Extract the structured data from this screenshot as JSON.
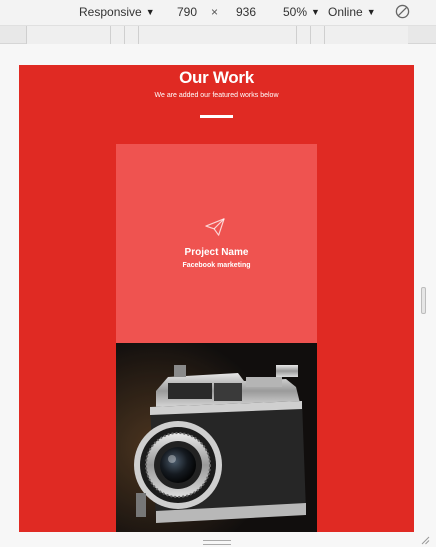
{
  "toolbar": {
    "device": "Responsive",
    "width": "790",
    "times": "×",
    "height": "936",
    "zoom": "50%",
    "throttle": "Online"
  },
  "page": {
    "title": "Our Work",
    "subtitle": "We are added our featured works below",
    "project": {
      "name": "Project Name",
      "category": "Facebook marketing",
      "icon": "paper-plane-icon"
    }
  },
  "colors": {
    "accent": "#e02a23",
    "card_overlay": "#ef5350",
    "text": "#ffffff"
  }
}
